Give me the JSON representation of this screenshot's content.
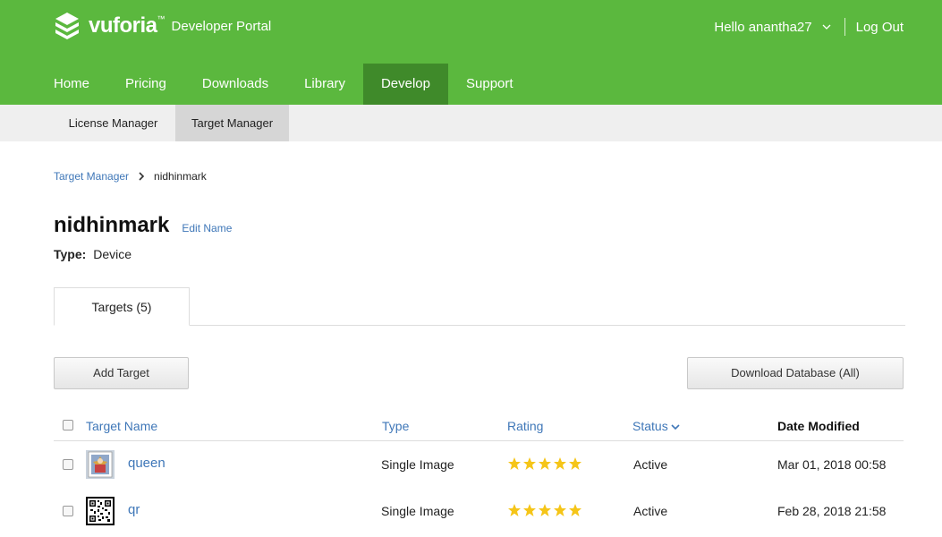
{
  "header": {
    "logo_word": "vuforia",
    "logo_tm": "™",
    "portal_label": "Developer Portal",
    "greeting": "Hello anantha27",
    "logout_label": "Log Out",
    "brand_color": "#5bb83e"
  },
  "main_nav": {
    "items": [
      {
        "label": "Home"
      },
      {
        "label": "Pricing"
      },
      {
        "label": "Downloads"
      },
      {
        "label": "Library"
      },
      {
        "label": "Develop",
        "active": true
      },
      {
        "label": "Support"
      }
    ]
  },
  "sub_nav": {
    "items": [
      {
        "label": "License Manager"
      },
      {
        "label": "Target Manager",
        "active": true
      }
    ]
  },
  "breadcrumb": {
    "parent": "Target Manager",
    "current": "nidhinmark"
  },
  "database": {
    "name": "nidhinmark",
    "edit_label": "Edit Name",
    "type_label": "Type:",
    "type_value": "Device"
  },
  "tabs": [
    {
      "label": "Targets (5)",
      "active": true
    }
  ],
  "actions": {
    "add_target": "Add Target",
    "download_db": "Download Database (All)"
  },
  "table": {
    "columns": {
      "name": "Target Name",
      "type": "Type",
      "rating": "Rating",
      "status": "Status",
      "date": "Date Modified"
    },
    "rows": [
      {
        "name": "queen",
        "type": "Single Image",
        "rating": 5,
        "status": "Active",
        "date": "Mar 01, 2018 00:58",
        "thumb_icon": "queen-card-thumbnail-icon"
      },
      {
        "name": "qr",
        "type": "Single Image",
        "rating": 5,
        "status": "Active",
        "date": "Feb 28, 2018 21:58",
        "thumb_icon": "qr-code-thumbnail-icon"
      }
    ]
  },
  "colors": {
    "link": "#3f77b8",
    "nav_active": "#3f8a2a",
    "star": "#f5c518"
  }
}
